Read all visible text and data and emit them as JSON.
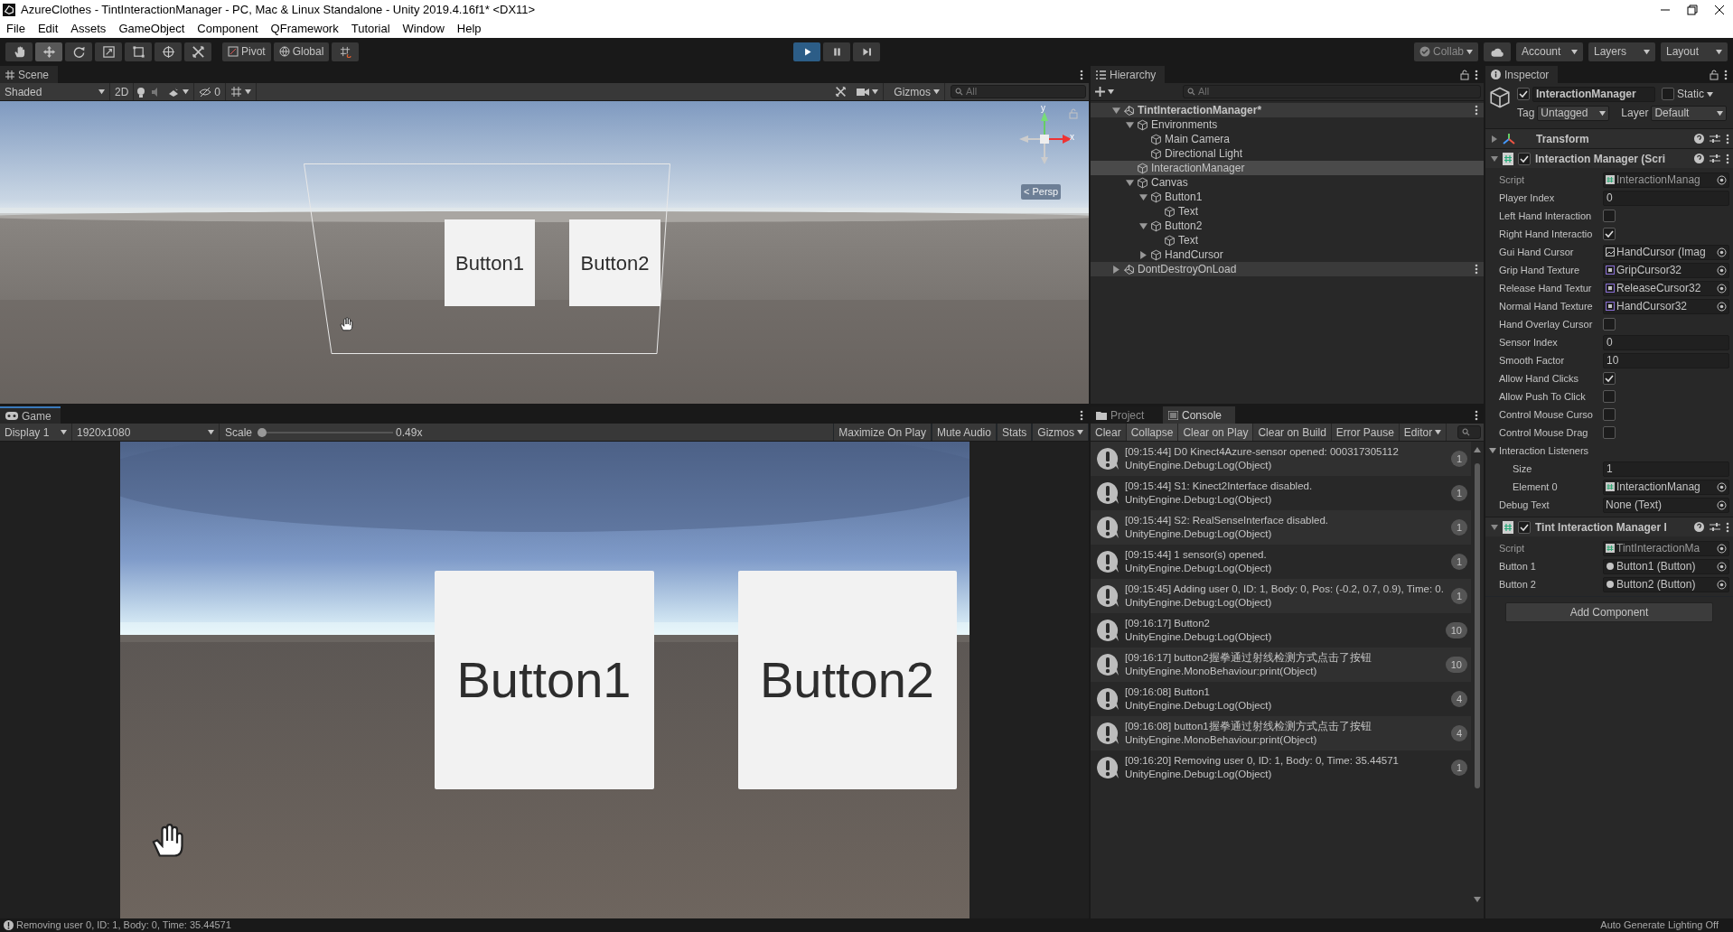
{
  "window": {
    "title": "AzureClothes - TintInteractionManager - PC, Mac & Linux Standalone - Unity 2019.4.16f1* <DX11>"
  },
  "menu": [
    "File",
    "Edit",
    "Assets",
    "GameObject",
    "Component",
    "QFramework",
    "Tutorial",
    "Window",
    "Help"
  ],
  "toolbar": {
    "tools": [
      {
        "kind": "hand",
        "selected": false
      },
      {
        "kind": "move",
        "selected": true
      },
      {
        "kind": "rotate",
        "selected": false
      },
      {
        "kind": "scale",
        "selected": false
      },
      {
        "kind": "rect",
        "selected": false
      },
      {
        "kind": "transform",
        "selected": false
      },
      {
        "kind": "custom",
        "selected": false
      }
    ],
    "pivot": "Pivot",
    "global": "Global",
    "play": [
      {
        "kind": "play",
        "on": true
      },
      {
        "kind": "pause",
        "on": false
      },
      {
        "kind": "step",
        "on": false
      }
    ],
    "collab": "Collab",
    "account": "Account",
    "layers": "Layers",
    "layout": "Layout"
  },
  "scene": {
    "tab": "Scene",
    "shading": "Shaded",
    "mode_2d": "2D",
    "hidden_count": "0",
    "gizmos": "Gizmos",
    "search_placeholder": "All",
    "axis_labels": [
      "y",
      "x"
    ],
    "persp": "< Persp",
    "buttons": [
      "Button1",
      "Button2"
    ]
  },
  "hierarchy": {
    "tab": "Hierarchy",
    "search_placeholder": "All",
    "items": [
      {
        "label": "TintInteractionManager*",
        "kind": "scene",
        "active": true,
        "expanded": true,
        "selected": false,
        "children": [
          {
            "label": "Environments",
            "kind": "object",
            "expanded": true,
            "selected": false,
            "children": [
              {
                "label": "Main Camera",
                "kind": "object",
                "selected": false
              },
              {
                "label": "Directional Light",
                "kind": "object",
                "selected": false
              }
            ]
          },
          {
            "label": "InteractionManager",
            "kind": "object",
            "selected": true
          },
          {
            "label": "Canvas",
            "kind": "object",
            "expanded": true,
            "selected": false,
            "children": [
              {
                "label": "Button1",
                "kind": "object",
                "expanded": true,
                "selected": false,
                "children": [
                  {
                    "label": "Text",
                    "kind": "object",
                    "selected": false
                  }
                ]
              },
              {
                "label": "Button2",
                "kind": "object",
                "expanded": true,
                "selected": false,
                "children": [
                  {
                    "label": "Text",
                    "kind": "object",
                    "selected": false
                  }
                ]
              },
              {
                "label": "HandCursor",
                "kind": "object",
                "expanded": false,
                "selected": false
              }
            ]
          }
        ]
      },
      {
        "label": "DontDestroyOnLoad",
        "kind": "scene",
        "active": false,
        "expanded": false,
        "selected": false
      }
    ]
  },
  "game": {
    "tab": "Game",
    "display": "Display 1",
    "resolution": "1920x1080",
    "scale_label": "Scale",
    "scale": {
      "level": 0.0
    },
    "scale_value": "0.49x",
    "options": [
      "Maximize On Play",
      "Mute Audio",
      "Stats"
    ],
    "gizmos": "Gizmos",
    "buttons": [
      "Button1",
      "Button2"
    ]
  },
  "console": {
    "tabs": [
      {
        "label": "Project",
        "kind": "project",
        "selected": false
      },
      {
        "label": "Console",
        "kind": "console",
        "selected": true
      }
    ],
    "toolbar": [
      {
        "label": "Clear",
        "on": false
      },
      {
        "label": "Collapse",
        "on": true
      },
      {
        "label": "Clear on Play",
        "on": true
      },
      {
        "label": "Clear on Build",
        "on": false
      },
      {
        "label": "Error Pause",
        "on": false
      }
    ],
    "editor": "Editor",
    "entries": [
      {
        "message": "[09:15:44] D0 Kinect4Azure-sensor opened: 000317305112",
        "source": "UnityEngine.Debug:Log(Object)",
        "count": "1"
      },
      {
        "message": "[09:15:44] S1: Kinect2Interface disabled.",
        "source": "UnityEngine.Debug:Log(Object)",
        "count": "1"
      },
      {
        "message": "[09:15:44] S2: RealSenseInterface disabled.",
        "source": "UnityEngine.Debug:Log(Object)",
        "count": "1"
      },
      {
        "message": "[09:15:44] 1 sensor(s) opened.",
        "source": "UnityEngine.Debug:Log(Object)",
        "count": "1"
      },
      {
        "message": "[09:15:45] Adding user 0, ID: 1, Body: 0, Pos: (-0.2, 0.7, 0.9), Time: 0.",
        "source": "UnityEngine.Debug:Log(Object)",
        "count": "1"
      },
      {
        "message": "[09:16:17] Button2",
        "source": "UnityEngine.Debug:Log(Object)",
        "count": "10"
      },
      {
        "message": "[09:16:17] button2握拳通过射线检测方式点击了按钮",
        "source": "UnityEngine.MonoBehaviour:print(Object)",
        "count": "10"
      },
      {
        "message": "[09:16:08] Button1",
        "source": "UnityEngine.Debug:Log(Object)",
        "count": "4"
      },
      {
        "message": "[09:16:08] button1握拳通过射线检测方式点击了按钮",
        "source": "UnityEngine.MonoBehaviour:print(Object)",
        "count": "4"
      },
      {
        "message": "[09:16:20] Removing user 0, ID: 1, Body: 0, Time: 35.44571",
        "source": "UnityEngine.Debug:Log(Object)",
        "count": "1"
      }
    ]
  },
  "inspector": {
    "tab": "Inspector",
    "object": {
      "active": true,
      "name": "InteractionManager",
      "static": false,
      "static_label": "Static",
      "tag_label": "Tag",
      "tag": "Untagged",
      "layer_label": "Layer",
      "layer": "Default"
    },
    "components": [
      {
        "kind": "transform",
        "title": "Transform",
        "expanded": false
      },
      {
        "kind": "script",
        "title": "Interaction Manager (Scri",
        "enabled": true,
        "expanded": true,
        "fields": [
          {
            "label": "Script",
            "kind": "script_ref",
            "value": "InteractionManag",
            "disabled": true
          },
          {
            "label": "Player Index",
            "kind": "text",
            "value": "0"
          },
          {
            "label": "Left Hand Interaction",
            "kind": "checkbox",
            "checked": false
          },
          {
            "label": "Right Hand Interactio",
            "kind": "checkbox",
            "checked": true
          },
          {
            "label": "Gui Hand Cursor",
            "kind": "image_ref",
            "value": "HandCursor (Imag"
          },
          {
            "label": "Grip Hand Texture",
            "kind": "texture_ref",
            "value": "GripCursor32"
          },
          {
            "label": "Release Hand Textur",
            "kind": "texture_ref",
            "value": "ReleaseCursor32"
          },
          {
            "label": "Normal Hand Texture",
            "kind": "texture_ref",
            "value": "HandCursor32"
          },
          {
            "label": "Hand Overlay Cursor",
            "kind": "checkbox",
            "checked": false
          },
          {
            "label": "Sensor Index",
            "kind": "text",
            "value": "0"
          },
          {
            "label": "Smooth Factor",
            "kind": "text",
            "value": "10"
          },
          {
            "label": "Allow Hand Clicks",
            "kind": "checkbox",
            "checked": true
          },
          {
            "label": "Allow Push To Click",
            "kind": "checkbox",
            "checked": false
          },
          {
            "label": "Control Mouse Curso",
            "kind": "checkbox",
            "checked": false
          },
          {
            "label": "Control Mouse Drag",
            "kind": "checkbox",
            "checked": false
          },
          {
            "label": "Interaction Listeners",
            "kind": "foldout",
            "expanded": true,
            "children": [
              {
                "label": "Size",
                "kind": "text",
                "value": "1"
              },
              {
                "label": "Element 0",
                "kind": "script_ref",
                "value": "InteractionManag"
              }
            ]
          },
          {
            "label": "Debug Text",
            "kind": "object",
            "value": "None (Text)"
          }
        ]
      },
      {
        "kind": "script",
        "title": "Tint Interaction Manager I",
        "enabled": true,
        "expanded": true,
        "fields": [
          {
            "label": "Script",
            "kind": "script_ref",
            "value": "TintInteractionMa",
            "disabled": true
          },
          {
            "label": "Button 1",
            "kind": "component_ref",
            "value": "Button1 (Button)"
          },
          {
            "label": "Button 2",
            "kind": "component_ref",
            "value": "Button2 (Button)"
          }
        ]
      }
    ],
    "add_component": "Add Component"
  },
  "status_bar": {
    "message": "Removing user 0, ID: 1, Body: 0, Time: 35.44571",
    "lighting": "Auto Generate Lighting Off"
  }
}
